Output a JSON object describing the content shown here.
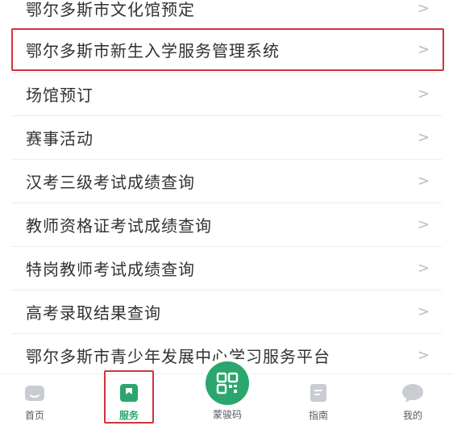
{
  "services": {
    "items": [
      {
        "label": "鄂尔多斯市文化馆预定"
      },
      {
        "label": "鄂尔多斯市新生入学服务管理系统"
      },
      {
        "label": "场馆预订"
      },
      {
        "label": "赛事活动"
      },
      {
        "label": "汉考三级考试成绩查询"
      },
      {
        "label": "教师资格证考试成绩查询"
      },
      {
        "label": "特岗教师考试成绩查询"
      },
      {
        "label": "高考录取结果查询"
      },
      {
        "label": "鄂尔多斯市青少年发展中心学习服务平台"
      }
    ],
    "chevron": ">"
  },
  "tabbar": {
    "home": "首页",
    "service": "服务",
    "qrcode": "蒙骏码",
    "guide": "指南",
    "mine": "我的"
  },
  "colors": {
    "accent": "#2aa66e",
    "highlight": "#d0343b",
    "icon_gray": "#c9ccd1"
  }
}
